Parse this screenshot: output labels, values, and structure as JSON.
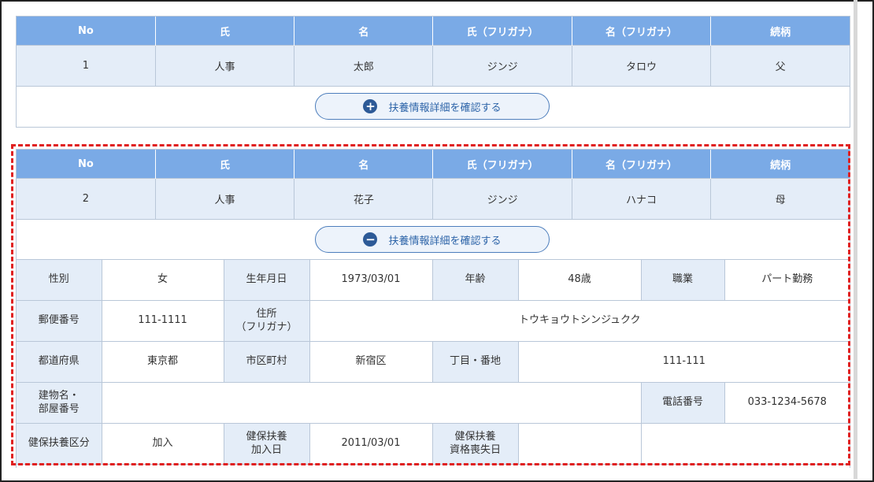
{
  "columns": [
    "No",
    "氏",
    "名",
    "氏（フリガナ）",
    "名（フリガナ）",
    "続柄"
  ],
  "dependents": [
    {
      "no": "1",
      "last_name": "人事",
      "first_name": "太郎",
      "last_kana": "ジンジ",
      "first_kana": "タロウ",
      "relation": "父",
      "button_label": "扶養情報詳細を確認する",
      "button_icon": "plus-circle-icon",
      "button_glyph": "+"
    },
    {
      "no": "2",
      "last_name": "人事",
      "first_name": "花子",
      "last_kana": "ジンジ",
      "first_kana": "ハナコ",
      "relation": "母",
      "button_label": "扶養情報詳細を確認する",
      "button_icon": "minus-circle-icon",
      "button_glyph": "−"
    }
  ],
  "detail": {
    "gender_label": "性別",
    "gender": "女",
    "birthdate_label": "生年月日",
    "birthdate": "1973/03/01",
    "age_label": "年齢",
    "age": "48歳",
    "occupation_label": "職業",
    "occupation": "パート勤務",
    "postal_label": "郵便番号",
    "postal": "111-1111",
    "address_kana_label_1": "住所",
    "address_kana_label_2": "（フリガナ）",
    "address_kana": "トウキョウトシンジュクク",
    "prefecture_label": "都道府県",
    "prefecture": "東京都",
    "city_label": "市区町村",
    "city": "新宿区",
    "block_label": "丁目・番地",
    "block": "111-111",
    "building_label_1": "建物名・",
    "building_label_2": "部屋番号",
    "building": "",
    "phone_label": "電話番号",
    "phone": "033-1234-5678",
    "insurance_type_label": "健保扶養区分",
    "insurance_type": "加入",
    "insurance_join_label_1": "健保扶養",
    "insurance_join_label_2": "加入日",
    "insurance_join": "2011/03/01",
    "insurance_loss_label_1": "健保扶養",
    "insurance_loss_label_2": "資格喪失日",
    "insurance_loss": ""
  },
  "colors": {
    "header": "#7aaae6",
    "row_bg": "#e4edf8",
    "highlight_border": "#e02020",
    "button_border": "#4d7ebc"
  }
}
